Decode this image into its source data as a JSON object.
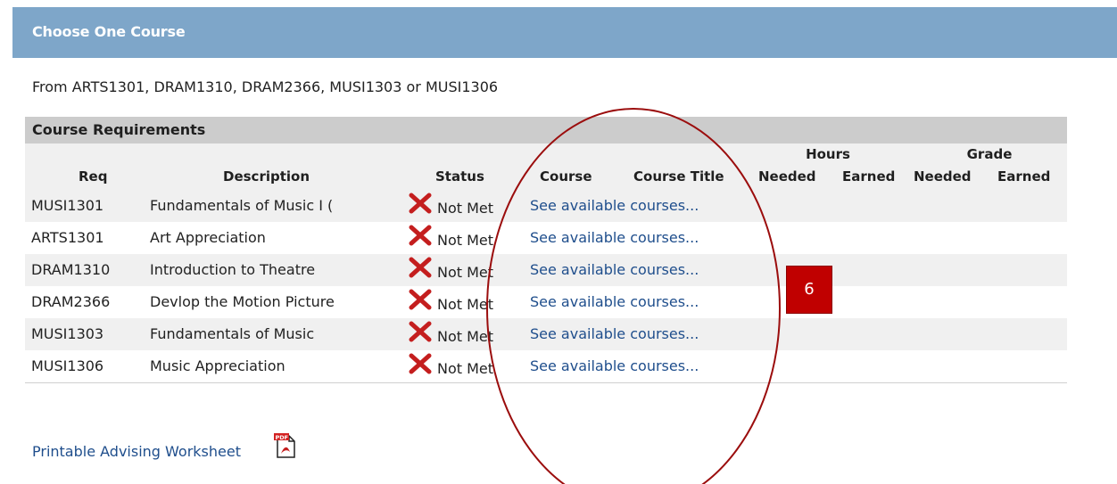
{
  "header": {
    "title": "Choose One Course"
  },
  "intro": {
    "text": "From ARTS1301, DRAM1310, DRAM2366, MUSI1303 or MUSI1306"
  },
  "requirements": {
    "title": "Course Requirements",
    "columns": {
      "req": "Req",
      "description": "Description",
      "status": "Status",
      "course": "Course",
      "course_title": "Course Title",
      "hours_group": "Hours",
      "grade_group": "Grade",
      "hours_needed": "Needed",
      "hours_earned": "Earned",
      "grade_needed": "Needed",
      "grade_earned": "Earned"
    },
    "rows": [
      {
        "req": "MUSI1301",
        "description": "Fundamentals of Music I (",
        "status": "Not Met",
        "link": "See available courses..."
      },
      {
        "req": "ARTS1301",
        "description": "Art Appreciation",
        "status": "Not Met",
        "link": "See available courses..."
      },
      {
        "req": "DRAM1310",
        "description": "Introduction to Theatre",
        "status": "Not Met",
        "link": "See available courses..."
      },
      {
        "req": "DRAM2366",
        "description": "Devlop the Motion Picture",
        "status": "Not Met",
        "link": "See available courses..."
      },
      {
        "req": "MUSI1303",
        "description": "Fundamentals of Music",
        "status": "Not Met",
        "link": "See available courses..."
      },
      {
        "req": "MUSI1306",
        "description": "Music Appreciation",
        "status": "Not Met",
        "link": "See available courses..."
      }
    ]
  },
  "footer": {
    "print_link": "Printable Advising Worksheet",
    "print_icon": "pdf-icon"
  },
  "annotation": {
    "badge": "6"
  },
  "colors": {
    "header_bg": "#7ea6c9",
    "status_x": "#c41e1e",
    "link": "#1f4e8c",
    "annotation": "#c00000"
  }
}
